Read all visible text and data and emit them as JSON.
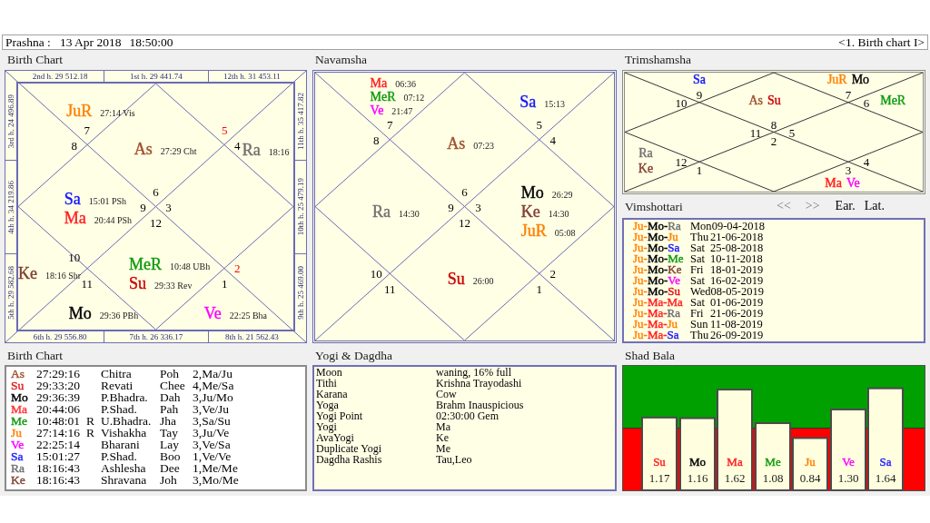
{
  "header": {
    "title": "Prashna :",
    "date": "13 Apr 2018",
    "time": "18:50:00",
    "chart_selector": "<1. Birth chart I>"
  },
  "birth_chart": {
    "title": "Birth Chart",
    "houses": [
      {
        "house_label": "2nd h. 29 512.18",
        "sign": "7",
        "dagdha": false,
        "planets": [
          {
            "name": "JuR",
            "color": "#ff8000",
            "degree": "27:14",
            "nakshatra": "Vis"
          }
        ]
      },
      {
        "house_label": "3rd h. 24 496.89",
        "sign": "8",
        "dagdha": false
      },
      {
        "house_label": "1st h. 29 441.74",
        "sign": "6",
        "dagdha": false,
        "planets": [
          {
            "name": "As",
            "color": "#a0522d",
            "degree": "27:29",
            "nakshatra": "Cht"
          }
        ]
      },
      {
        "house_label": "12th h. 31 453.11",
        "sign": "5",
        "dagdha": true
      },
      {
        "house_label": "11th h. 35 417.82",
        "sign": "4",
        "dagdha": false,
        "planets": [
          {
            "name": "Ra",
            "color": "#707070",
            "degree": "18:16"
          }
        ]
      },
      {
        "house_label": "4th h. 34 219.86",
        "sign": "9",
        "dagdha": false,
        "planets": [
          {
            "name": "Sa",
            "color": "#1515ff",
            "degree": "15:01",
            "nakshatra": "PSh"
          },
          {
            "name": "Ma",
            "color": "#ff2020",
            "degree": "20:44",
            "nakshatra": "PSh"
          }
        ]
      },
      {
        "house_label": "10th h. 25 479.19",
        "sign": "3",
        "dagdha": false
      },
      {
        "house_label": "5th h. 29 582.68",
        "sign": "10",
        "dagdha": false,
        "planets": [
          {
            "name": "Ke",
            "color": "#804030",
            "degree": "18:16",
            "nakshatra": "Shr"
          }
        ]
      },
      {
        "house_label": "6th h. 29 556.80",
        "sign": "11",
        "dagdha": false,
        "planets": [
          {
            "name": "Mo",
            "color": "#000000",
            "degree": "29:36",
            "nakshatra": "PBh"
          }
        ]
      },
      {
        "house_label": "7th h. 26 336.17",
        "sign": "12",
        "dagdha": false,
        "planets": [
          {
            "name": "MeR",
            "color": "#119911",
            "degree": "10:48",
            "nakshatra": "UBh"
          },
          {
            "name": "Su",
            "color": "#cc0000",
            "degree": "29:33",
            "nakshatra": "Rev"
          }
        ]
      },
      {
        "house_label": "8th h. 21 562.43",
        "sign": "1",
        "dagdha": false,
        "planets": [
          {
            "name": "Ve",
            "color": "#ff00ff",
            "degree": "22:25",
            "nakshatra": "Bha"
          }
        ]
      },
      {
        "house_label": "9th h. 25 469.00",
        "sign": "2",
        "dagdha": true
      }
    ]
  },
  "navamsha": {
    "title": "Navamsha",
    "houses": [
      {
        "sign": "7",
        "planets": [
          {
            "name": "Ma",
            "color": "#ff2020",
            "degree": "06:36"
          },
          {
            "name": "MeR",
            "color": "#119911",
            "degree": "07:12"
          },
          {
            "name": "Ve",
            "color": "#ff00ff",
            "degree": "21:47"
          }
        ]
      },
      {
        "sign": "8"
      },
      {
        "sign": "6",
        "planets": [
          {
            "name": "As",
            "color": "#a0522d",
            "degree": "07:23"
          }
        ]
      },
      {
        "sign": "5",
        "planets": [
          {
            "name": "Sa",
            "color": "#1515ff",
            "degree": "15:13"
          }
        ]
      },
      {
        "sign": "4"
      },
      {
        "sign": "9",
        "planets": [
          {
            "name": "Ra",
            "color": "#707070",
            "degree": "14:30"
          }
        ]
      },
      {
        "sign": "3",
        "planets": [
          {
            "name": "Mo",
            "color": "#000000",
            "degree": "26:29"
          },
          {
            "name": "Ke",
            "color": "#804030",
            "degree": "14:30"
          },
          {
            "name": "JuR",
            "color": "#ff8000",
            "degree": "05:08"
          }
        ]
      },
      {
        "sign": "10"
      },
      {
        "sign": "11"
      },
      {
        "sign": "12",
        "planets": [
          {
            "name": "Su",
            "color": "#cc0000",
            "degree": "26:00"
          }
        ]
      },
      {
        "sign": "1"
      },
      {
        "sign": "2"
      }
    ]
  },
  "trimshamsha": {
    "title": "Trimshamsha",
    "houses": [
      {
        "sign": "10"
      },
      {
        "sign": "9",
        "planets": [
          {
            "name": "Sa",
            "color": "#1515ff"
          }
        ]
      },
      {
        "sign": "8",
        "planets": [
          {
            "name": "As",
            "color": "#a0522d"
          },
          {
            "name": "Su",
            "color": "#cc0000"
          }
        ]
      },
      {
        "sign": "7",
        "planets": [
          {
            "name": "JuR",
            "color": "#ff8000"
          },
          {
            "name": "Mo",
            "color": "#000000"
          }
        ]
      },
      {
        "sign": "6",
        "planets": [
          {
            "name": "MeR",
            "color": "#119911"
          }
        ]
      },
      {
        "sign": "11"
      },
      {
        "sign": "2"
      },
      {
        "sign": "5"
      },
      {
        "sign": "12",
        "planets": [
          {
            "name": "Ra",
            "color": "#707070"
          },
          {
            "name": "Ke",
            "color": "#804030"
          }
        ]
      },
      {
        "sign": "1"
      },
      {
        "sign": "3",
        "planets": [
          {
            "name": "Ma",
            "color": "#ff2020"
          },
          {
            "name": "Ve",
            "color": "#ff00ff"
          }
        ]
      },
      {
        "sign": "4"
      }
    ]
  },
  "vimshottari": {
    "title": "Vimshottari",
    "controls": [
      {
        "label": "<<",
        "disabled": true
      },
      {
        "label": ">>",
        "disabled": true
      },
      {
        "label": "Ear.",
        "disabled": false
      },
      {
        "label": "Lat.",
        "disabled": false
      }
    ],
    "periods": [
      {
        "lords": [
          {
            "name": "Ju-",
            "color": "#ff8000"
          },
          {
            "name": "Mo-",
            "color": "#000000"
          },
          {
            "name": "Ra",
            "color": "#707070"
          }
        ],
        "day": "Mon",
        "date": "09-04-2018"
      },
      {
        "lords": [
          {
            "name": "Ju-",
            "color": "#ff8000"
          },
          {
            "name": "Mo-",
            "color": "#000000"
          },
          {
            "name": "Ju",
            "color": "#ff8000"
          }
        ],
        "day": "Thu",
        "date": "21-06-2018"
      },
      {
        "lords": [
          {
            "name": "Ju-",
            "color": "#ff8000"
          },
          {
            "name": "Mo-",
            "color": "#000000"
          },
          {
            "name": "Sa",
            "color": "#1515ff"
          }
        ],
        "day": "Sat",
        "date": "25-08-2018"
      },
      {
        "lords": [
          {
            "name": "Ju-",
            "color": "#ff8000"
          },
          {
            "name": "Mo-",
            "color": "#000000"
          },
          {
            "name": "Me",
            "color": "#119911"
          }
        ],
        "day": "Sat",
        "date": "10-11-2018"
      },
      {
        "lords": [
          {
            "name": "Ju-",
            "color": "#ff8000"
          },
          {
            "name": "Mo-",
            "color": "#000000"
          },
          {
            "name": "Ke",
            "color": "#804030"
          }
        ],
        "day": "Fri",
        "date": "18-01-2019"
      },
      {
        "lords": [
          {
            "name": "Ju-",
            "color": "#ff8000"
          },
          {
            "name": "Mo-",
            "color": "#000000"
          },
          {
            "name": "Ve",
            "color": "#ff00ff"
          }
        ],
        "day": "Sat",
        "date": "16-02-2019"
      },
      {
        "lords": [
          {
            "name": "Ju-",
            "color": "#ff8000"
          },
          {
            "name": "Mo-",
            "color": "#000000"
          },
          {
            "name": "Su",
            "color": "#dd1111"
          }
        ],
        "day": "Wed",
        "date": "08-05-2019"
      },
      {
        "lords": [
          {
            "name": "Ju-",
            "color": "#ff8000"
          },
          {
            "name": "Ma-",
            "color": "#ff2020"
          },
          {
            "name": "Ma",
            "color": "#ff2020"
          }
        ],
        "day": "Sat",
        "date": "01-06-2019"
      },
      {
        "lords": [
          {
            "name": "Ju-",
            "color": "#ff8000"
          },
          {
            "name": "Ma-",
            "color": "#ff2020"
          },
          {
            "name": "Ra",
            "color": "#707070"
          }
        ],
        "day": "Fri",
        "date": "21-06-2019"
      },
      {
        "lords": [
          {
            "name": "Ju-",
            "color": "#ff8000"
          },
          {
            "name": "Ma-",
            "color": "#ff2020"
          },
          {
            "name": "Ju",
            "color": "#ff8000"
          }
        ],
        "day": "Sun",
        "date": "11-08-2019"
      },
      {
        "lords": [
          {
            "name": "Ju-",
            "color": "#ff8000"
          },
          {
            "name": "Ma-",
            "color": "#ff2020"
          },
          {
            "name": "Sa",
            "color": "#1515ff"
          }
        ],
        "day": "Thu",
        "date": "26-09-2019"
      }
    ]
  },
  "planet_table": {
    "title": "Birth Chart",
    "rows": [
      {
        "planet": "As",
        "color": "#a0522d",
        "longitude": "27:29:16",
        "nakshatra": "Chitra",
        "syllable": "Poh",
        "pada": "2,Ma/Ju"
      },
      {
        "planet": "Su",
        "color": "#e02020",
        "longitude": "29:33:20",
        "nakshatra": "Revati",
        "syllable": "Chee",
        "pada": "4,Me/Sa"
      },
      {
        "planet": "Mo",
        "color": "#000000",
        "longitude": "29:36:39",
        "nakshatra": "P.Bhadra.",
        "syllable": "Dah",
        "pada": "3,Ju/Mo"
      },
      {
        "planet": "Ma",
        "color": "#ff3030",
        "longitude": "20:44:06",
        "nakshatra": "P.Shad.",
        "syllable": "Pah",
        "pada": "3,Ve/Ju"
      },
      {
        "planet": "Me",
        "color": "#119911",
        "longitude": "10:48:01",
        "retrograde": "R",
        "nakshatra": "U.Bhadra.",
        "syllable": "Jha",
        "pada": "3,Sa/Su"
      },
      {
        "planet": "Ju",
        "color": "#ff8000",
        "longitude": "27:14:16",
        "retrograde": "R",
        "nakshatra": "Vishakha",
        "syllable": "Tay",
        "pada": "3,Ju/Ve"
      },
      {
        "planet": "Ve",
        "color": "#ff00ff",
        "longitude": "22:25:14",
        "nakshatra": "Bharani",
        "syllable": "Lay",
        "pada": "3,Ve/Sa"
      },
      {
        "planet": "Sa",
        "color": "#2020ff",
        "longitude": "15:01:27",
        "nakshatra": "P.Shad.",
        "syllable": "Boo",
        "pada": "1,Ve/Ve"
      },
      {
        "planet": "Ra",
        "color": "#707070",
        "longitude": "18:16:43",
        "nakshatra": "Ashlesha",
        "syllable": "Dee",
        "pada": "1,Me/Me"
      },
      {
        "planet": "Ke",
        "color": "#804030",
        "longitude": "18:16:43",
        "nakshatra": "Shravana",
        "syllable": "Joh",
        "pada": "3,Mo/Me"
      }
    ]
  },
  "yogi_dagdha": {
    "title": "Yogi & Dagdha",
    "rows": [
      {
        "label": "Moon",
        "value": "waning, 16% full"
      },
      {
        "label": "Tithi",
        "value": "Krishna Trayodashi"
      },
      {
        "label": "Karana",
        "value": "Cow"
      },
      {
        "label": "Yoga",
        "value": "Brahm Inauspicious"
      },
      {
        "label": "Yogi Point",
        "value": "02:30:00 Gem"
      },
      {
        "label": "Yogi",
        "value": "Ma"
      },
      {
        "label": "AvaYogi",
        "value": "Ke"
      },
      {
        "label": "Duplicate Yogi",
        "value": "Me"
      },
      {
        "label": "Dagdha Rashis",
        "value": "Tau,Leo"
      }
    ]
  },
  "shad_bala": {
    "title": "Shad Bala",
    "category_labels": [
      {
        "color": "#ff2020"
      },
      {
        "color": "#000000"
      },
      {
        "color": "#ff2020"
      },
      {
        "color": "#119911"
      },
      {
        "color": "#ff8000"
      },
      {
        "color": "#ff00ff"
      },
      {
        "color": "#2020ff"
      }
    ],
    "chart_data": {
      "type": "bar",
      "categories": [
        "Su",
        "Mo",
        "Ma",
        "Me",
        "Ju",
        "Ve",
        "Sa"
      ],
      "values": [
        1.17,
        1.16,
        1.62,
        1.08,
        0.84,
        1.3,
        1.64
      ],
      "ylim": [
        0,
        2
      ],
      "value_labels": [
        "1.17",
        "1.16",
        "1.62",
        "1.08",
        "0.84",
        "1.30",
        "1.64"
      ]
    }
  }
}
